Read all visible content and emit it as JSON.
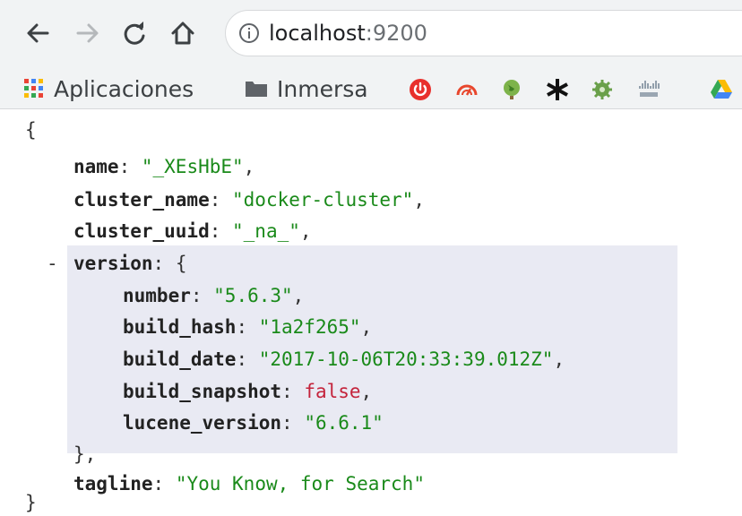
{
  "toolbar": {
    "back_icon": "arrow-left-icon",
    "forward_icon": "arrow-right-icon",
    "reload_icon": "reload-icon",
    "home_icon": "home-icon",
    "info_icon": "info-circle-icon",
    "url_host": "localhost",
    "url_port": ":9200"
  },
  "bookmarks": {
    "apps_label": "Aplicaciones",
    "folder_label": "Inmersa",
    "icons": [
      "power-icon",
      "gauge-icon",
      "globe-icon",
      "asterisk-icon",
      "gear-icon",
      "cisco-icon",
      "drive-icon"
    ]
  },
  "json": {
    "open_brace": "{",
    "close_brace": "}",
    "name_key": "name",
    "name_value": "\"_XEsHbE\"",
    "cluster_name_key": "cluster_name",
    "cluster_name_value": "\"docker-cluster\"",
    "cluster_uuid_key": "cluster_uuid",
    "cluster_uuid_value": "\"_na_\"",
    "collapse_toggle": "-",
    "version_key": "version",
    "version_open": "{",
    "number_key": "number",
    "number_value": "\"5.6.3\"",
    "build_hash_key": "build_hash",
    "build_hash_value": "\"1a2f265\"",
    "build_date_key": "build_date",
    "build_date_value": "\"2017-10-06T20:33:39.012Z\"",
    "build_snapshot_key": "build_snapshot",
    "build_snapshot_value": "false",
    "lucene_version_key": "lucene_version",
    "lucene_version_value": "\"6.6.1\"",
    "version_close": "},",
    "tagline_key": "tagline",
    "tagline_value": "\"You Know, for Search\""
  },
  "colors": {
    "string": "#1a8a1a",
    "boolean": "#c4233b",
    "highlight": "#e9eaf3",
    "chrome": "#f1f3f4"
  }
}
